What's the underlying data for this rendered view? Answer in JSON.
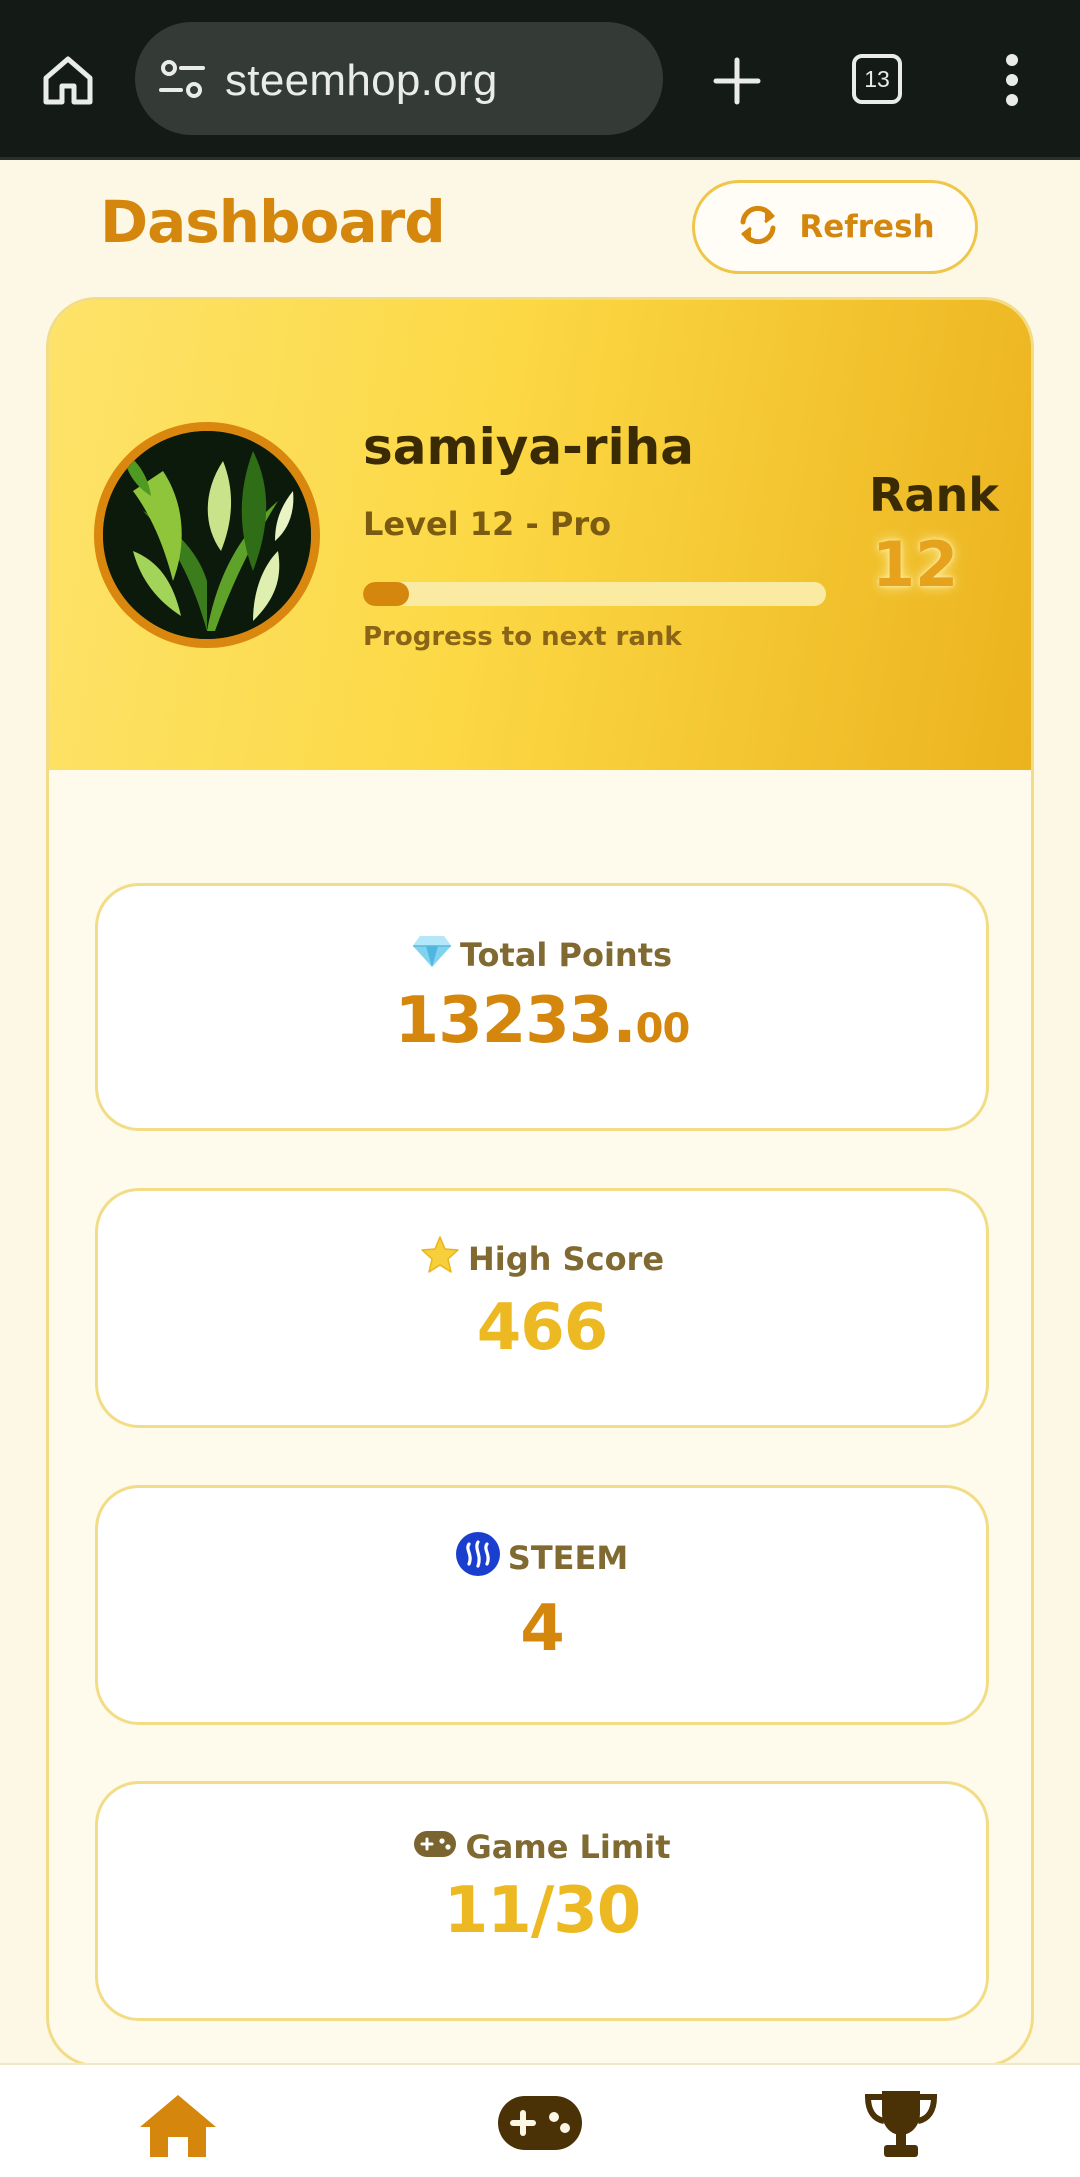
{
  "browser": {
    "url": "steemhop.org",
    "tab_count": "13",
    "home_icon": "home-icon",
    "site_settings_icon": "tune-icon",
    "new_tab_icon": "plus-icon",
    "menu_icon": "more-vert-icon"
  },
  "header": {
    "title": "Dashboard",
    "refresh_label": "Refresh",
    "refresh_icon": "sync-icon"
  },
  "profile": {
    "username": "samiya-riha",
    "level": "Level 12 - Pro",
    "progress_fraction": 0.1,
    "progress_caption": "Progress to next rank",
    "rank_label": "Rank",
    "rank_value": "12"
  },
  "stats": {
    "total_points": {
      "icon": "gem-icon",
      "label": "Total Points",
      "value_int": "13233.",
      "value_frac": "00"
    },
    "high_score": {
      "icon": "star-icon",
      "label": "High Score",
      "value": "466"
    },
    "steem": {
      "icon": "steem-logo-icon",
      "label": "STEEM",
      "value": "4"
    },
    "game_limit": {
      "icon": "gamepad-icon",
      "label": "Game Limit",
      "value": "11/30"
    }
  },
  "nav": [
    {
      "icon": "home-icon",
      "name": "nav-home"
    },
    {
      "icon": "gamepad-icon",
      "name": "nav-games"
    },
    {
      "icon": "trophy-icon",
      "name": "nav-leaderboard"
    }
  ],
  "colors": {
    "accent": "#d4870c",
    "gold": "#ecb923",
    "page_bg": "#fdf8e6",
    "header_gradient_start": "#fde36a",
    "header_gradient_end": "#ebb31e",
    "browser_bar": "#141a16"
  }
}
